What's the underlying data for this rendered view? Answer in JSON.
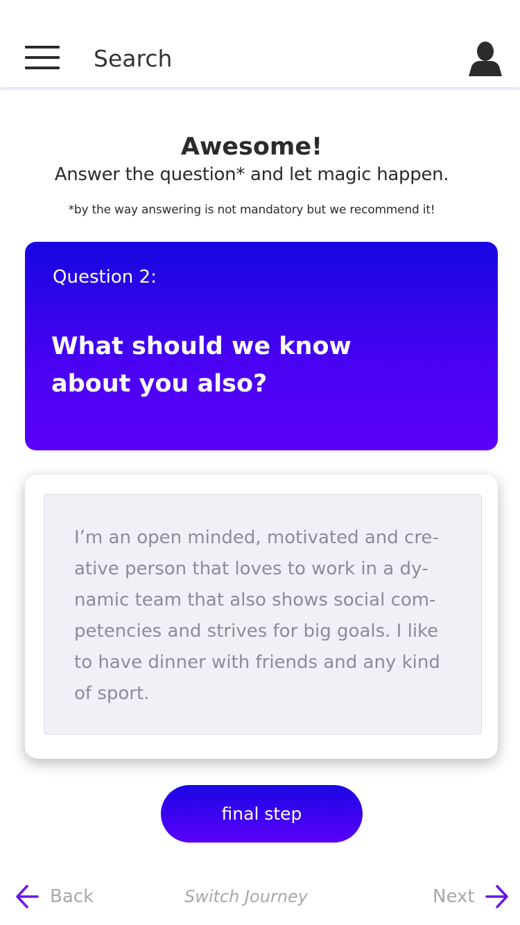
{
  "header": {
    "menu_icon": "hamburger-menu-icon",
    "search_label": "Search",
    "user_icon": "user-avatar-icon"
  },
  "intro": {
    "title": "Awesome!",
    "subtitle": "Answer the question* and let magic happen.",
    "note": "*by the way answering is not mandatory but we recommend it!"
  },
  "question": {
    "number_label": "Question 2:",
    "text": "What should we know about you also?"
  },
  "answer": {
    "value": "I’m an open minded, motivated and cre­ative person that loves to work in a dy­namic team that also shows social com­petencies and strives for big goals. I like to have dinner with friends and any kind of sport."
  },
  "actions": {
    "final_step_label": "final step"
  },
  "nav": {
    "back_label": "Back",
    "back_icon": "arrow-left-icon",
    "switch_label": "Switch Journey",
    "next_label": "Next",
    "next_icon": "arrow-right-icon"
  },
  "colors": {
    "accent_top": "#1707e0",
    "accent_bottom": "#5a00fa",
    "nav_arrow": "#6a14e8",
    "answer_bg": "#f3eff6",
    "text_dark": "#2b2b2b",
    "muted_text": "#a8a8a8"
  }
}
